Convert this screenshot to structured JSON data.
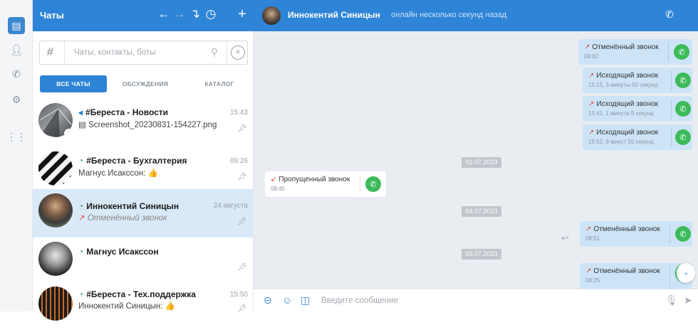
{
  "sidebar_header": {
    "title": "Чаты"
  },
  "search": {
    "placeholder": "Чаты, контакты, боты"
  },
  "tabs": [
    "ВСЕ ЧАТЫ",
    "ОБСУЖДЕНИЯ",
    "КАТАЛОГ"
  ],
  "chats": [
    {
      "name": "#Береста - Новости",
      "time": "15:43",
      "preview": "Screenshot_20230831-154227.png"
    },
    {
      "name": "#Береста - Бухгалтерия",
      "time": "09:26",
      "preview": "Магнус Исакссон: 👍"
    },
    {
      "name": "Иннокентий Синицын",
      "time": "24 августа",
      "preview": "Отменённый звонок",
      "selected": true
    },
    {
      "name": "Магнус Исакссон",
      "time": "",
      "preview": ""
    },
    {
      "name": "#Береста - Тех.поддержка",
      "time": "15:50",
      "preview": "Иннокентий Синицын: 👍"
    }
  ],
  "conversation": {
    "contact_name": "Иннокентий Синицын",
    "status": "онлайн несколько секунд назад"
  },
  "messages": [
    {
      "text": "Отменённый звонок",
      "meta": "09:02"
    },
    {
      "text": "Исходящий звонок",
      "meta": "15:15, 3 минуты 50 секунд"
    },
    {
      "text": "Исходящий звонок",
      "meta": "15:41, 1 минута 9 секунд"
    },
    {
      "text": "Исходящий звонок",
      "meta": "15:52, 9 минут 55 секунд"
    },
    {
      "text": "Пропущенный звонок",
      "meta": "08:45"
    },
    {
      "text": "Отменённый звонок",
      "meta": "08:51"
    },
    {
      "text": "Отменённый звонок",
      "meta": "08:25"
    }
  ],
  "dates": [
    "02.07.2023",
    "04.07.2023",
    "05.07.2023"
  ],
  "composer": {
    "placeholder": "Введите сообщение"
  },
  "colors": {
    "accent": "#2e84d6",
    "call_green": "#3dbb5a",
    "missed_red": "#e04a3a",
    "outgoing_bubble": "#cde4f7"
  }
}
